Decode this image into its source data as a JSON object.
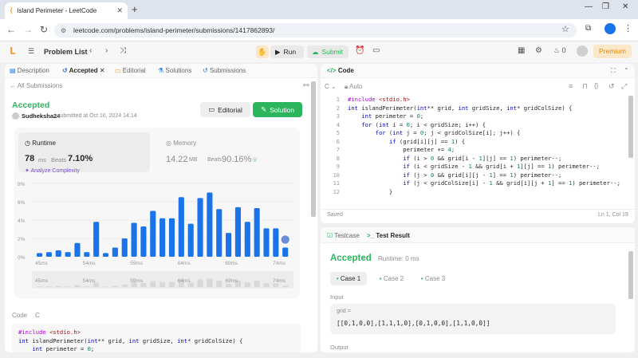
{
  "browser": {
    "tab_title": "Island Perimeter - LeetCode",
    "url": "leetcode.com/problems/island-perimeter/submissions/1417862893/"
  },
  "nav": {
    "problem_list": "Problem List",
    "run": "Run",
    "submit": "Submit",
    "fire_count": "0",
    "premium": "Premium"
  },
  "left": {
    "tabs": [
      "Description",
      "Accepted",
      "Editorial",
      "Solutions",
      "Submissions"
    ],
    "all_submissions": "All Submissions",
    "status": "Accepted",
    "user": "Sudheksha24",
    "submitted": "submitted at Oct 10, 2024 14:14",
    "editorial_btn": "Editorial",
    "solution_btn": "Solution",
    "runtime_label": "Runtime",
    "runtime_value": "78",
    "runtime_unit": "ms",
    "beats_label": "Beats",
    "runtime_beats": "7.10%",
    "analyze": "Analyze Complexity",
    "memory_label": "Memory",
    "memory_value": "14.22",
    "memory_unit": "MB",
    "memory_beats": "90.16%",
    "code_label": "Code",
    "code_lang": "C",
    "code_lines": [
      "#include <stdio.h>",
      "int islandPerimeter(int** grid, int gridSize, int* gridColSize) {",
      "    int perimeter = 0;"
    ]
  },
  "chart_data": {
    "type": "bar",
    "ylabel_ticks": [
      "8%",
      "6%",
      "4%",
      "2%",
      "0%"
    ],
    "ylim": [
      0,
      8
    ],
    "x_ticks": [
      "45ms",
      "54ms",
      "59ms",
      "64ms",
      "69ms",
      "74ms"
    ],
    "values": [
      0.4,
      0.5,
      0.7,
      0.5,
      1.5,
      0.5,
      3.8,
      0.4,
      1.0,
      2.0,
      3.7,
      3.3,
      5.0,
      4.2,
      4.2,
      6.5,
      3.6,
      6.4,
      7.0,
      5.2,
      2.6,
      5.4,
      3.8,
      5.3,
      3.1,
      3.1,
      1.0
    ],
    "highlight_index": 26,
    "color": "#1a73e8"
  },
  "editor": {
    "title": "Code",
    "lang": "C",
    "auto": "Auto",
    "saved": "Saved",
    "position": "Ln 1, Col 19",
    "lines": [
      "#include <stdio.h>",
      "int islandPerimeter(int** grid, int gridSize, int* gridColSize) {",
      "    int perimeter = 0;",
      "    for (int i = 0; i < gridSize; i++) {",
      "        for (int j = 0; j < gridColSize[i]; j++) {",
      "            if (grid[i][j] == 1) {",
      "                perimeter += 4;",
      "                if (i > 0 && grid[i - 1][j] == 1) perimeter--;",
      "                if (i < gridSize - 1 && grid[i + 1][j] == 1) perimeter--;",
      "                if (j > 0 && grid[i][j - 1] == 1) perimeter--;",
      "                if (j < gridColSize[i] - 1 && grid[i][j + 1] == 1) perimeter--;",
      "            }"
    ]
  },
  "result": {
    "testcase_tab": "Testcase",
    "result_tab": "Test Result",
    "status": "Accepted",
    "runtime": "Runtime: 0 ms",
    "cases": [
      "Case 1",
      "Case 2",
      "Case 3"
    ],
    "input_label": "Input",
    "var_name": "grid =",
    "var_value": "[[0,1,0,0],[1,1,1,0],[0,1,0,0],[1,1,0,0]]",
    "output_label": "Output"
  }
}
